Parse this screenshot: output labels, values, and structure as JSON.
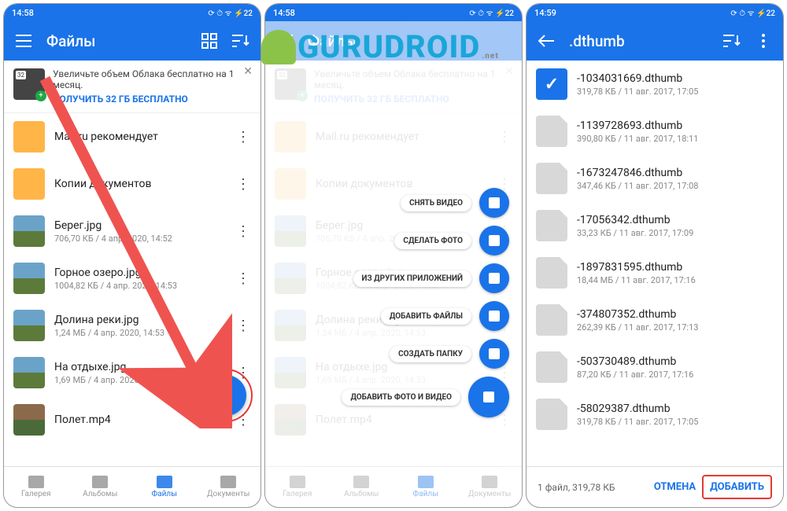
{
  "status": {
    "time": "14:58",
    "time3": "14:59",
    "icons": "⟳ ⏱ ᯤ ⚡22"
  },
  "screen1": {
    "title": "Файлы",
    "promo_text": "Увеличьте объем Облака бесплатно на 1 месяц.",
    "promo_link": "ПОЛУЧИТЬ 32 ГБ БЕСПЛАТНО",
    "items": [
      {
        "name": "Mail.ru рекомендует",
        "meta": "",
        "type": "folder"
      },
      {
        "name": "Копии документов",
        "meta": "",
        "type": "folder"
      },
      {
        "name": "Берег.jpg",
        "meta": "706,70 КБ / 4 апр. 2020, 14:52",
        "type": "img"
      },
      {
        "name": "Горное озеро.jpg",
        "meta": "1004,82 КБ / 4 апр. 2020, 14:53",
        "type": "img"
      },
      {
        "name": "Долина реки.jpg",
        "meta": "1,24 МБ / 4 апр. 2020, 14:53",
        "type": "img"
      },
      {
        "name": "На отдыхе.jpg",
        "meta": "1,69 МБ / 4 апр. 2020, 14:53",
        "type": "img"
      },
      {
        "name": "Полет.mp4",
        "meta": "",
        "type": "vid"
      }
    ],
    "nav": [
      "Галерея",
      "Альбомы",
      "Файлы",
      "Документы"
    ]
  },
  "screen2": {
    "fab_items": [
      "СНЯТЬ ВИДЕО",
      "СДЕЛАТЬ ФОТО",
      "ИЗ ДРУГИХ ПРИЛОЖЕНИЙ",
      "ДОБАВИТЬ ФАЙЛЫ",
      "СОЗДАТЬ ПАПКУ",
      "ДОБАВИТЬ ФОТО И ВИДЕО"
    ]
  },
  "screen3": {
    "title": ".dthumb",
    "items": [
      {
        "name": "-1034031669.dthumb",
        "meta": "319,78 КБ / 11 авг. 2017, 17:05",
        "sel": true
      },
      {
        "name": "-1139728693.dthumb",
        "meta": "390,80 КБ / 11 авг. 2017, 18:11"
      },
      {
        "name": "-1673247846.dthumb",
        "meta": "347,46 КБ / 11 авг. 2017, 17:08"
      },
      {
        "name": "-17056342.dthumb",
        "meta": "33,23 КБ / 11 авг. 2017, 17:09"
      },
      {
        "name": "-1897831595.dthumb",
        "meta": "18,44 МБ / 11 авг. 2017, 17:16"
      },
      {
        "name": "-374807352.dthumb",
        "meta": "262,39 КБ / 11 авг. 2017, 17:13"
      },
      {
        "name": "-503730489.dthumb",
        "meta": "87,20 КБ / 11 авг. 2017, 17:16"
      },
      {
        "name": "-58029387.dthumb",
        "meta": "319,78 КБ / 11 авг. 2017, 17:05"
      }
    ],
    "footer_status": "1 файл, 319,78 КБ",
    "cancel": "ОТМЕНА",
    "add": "ДОБАВИТЬ"
  },
  "watermark": {
    "text": "GURUDROID",
    "suffix": ".net"
  }
}
